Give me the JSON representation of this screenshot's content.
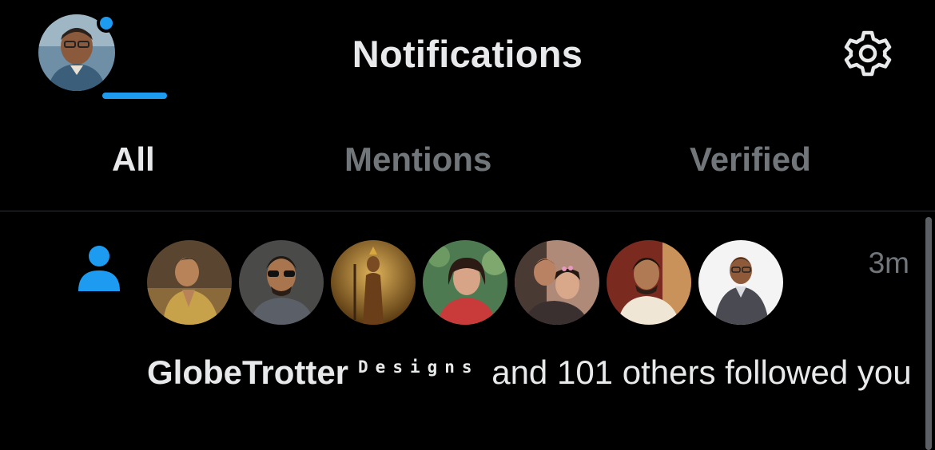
{
  "header": {
    "title": "Notifications",
    "profile_avatar": "user-avatar",
    "unread_dot_color": "#1d9bf0",
    "settings_icon": "gear-icon"
  },
  "tabs": [
    {
      "label": "All",
      "active": true
    },
    {
      "label": "Mentions",
      "active": false
    },
    {
      "label": "Verified",
      "active": false
    }
  ],
  "colors": {
    "accent": "#1d9bf0",
    "background": "#000000",
    "text_primary": "#e7e9ea",
    "text_secondary": "#71767b"
  },
  "notification": {
    "type_icon": "person-icon",
    "time": "3m",
    "avatar_count": 7,
    "user_name": "GlobeTrotter",
    "user_name_suffix": "Designs",
    "message": "and 101 others followed you"
  }
}
